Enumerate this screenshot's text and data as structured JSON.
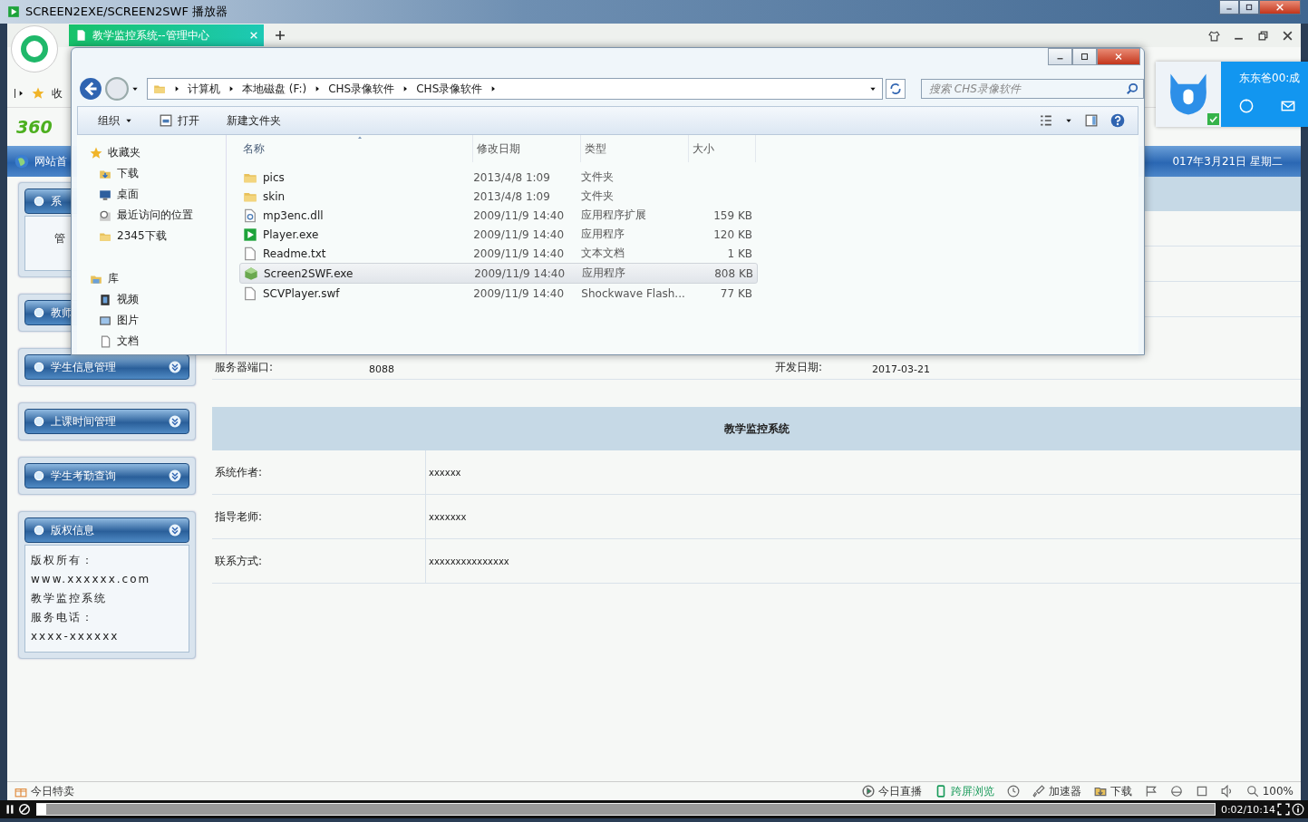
{
  "player": {
    "title": "SCREEN2EXE/SCREEN2SWF 播放器",
    "playing": true,
    "progress": {
      "level": 0.004
    },
    "time": "0:02/10:14"
  },
  "browser": {
    "tab": {
      "title": "教学监控系统--管理中心",
      "selected": true
    },
    "bookmark": "收",
    "logo": "360",
    "nav_item": "网站首",
    "date": "017年3月21日  星期二"
  },
  "sidebar": [
    {
      "title": "系",
      "lines": [
        "管"
      ]
    },
    {
      "title": "教师"
    },
    {
      "title": "学生信息管理",
      "chevron": true
    },
    {
      "title": "上课时间管理",
      "chevron": true
    },
    {
      "title": "学生考勤查询",
      "chevron": true
    },
    {
      "title": "版权信息",
      "chevron": true,
      "lines": [
        "版权所有：",
        "www.xxxxxx.com",
        "教学监控系统",
        "服务电话：",
        "xxxx-xxxxxx"
      ]
    }
  ],
  "server_info": [
    {
      "label": "服务器端口:",
      "value": "8088"
    },
    {
      "label": "开发日期:",
      "value": "2017-03-21"
    }
  ],
  "about": {
    "title": "教学监控系统",
    "rows": [
      {
        "label": "系统作者:",
        "value": "xxxxxx"
      },
      {
        "label": "指导老师:",
        "value": "xxxxxxx"
      },
      {
        "label": "联系方式:",
        "value": "xxxxxxxxxxxxxxx"
      }
    ]
  },
  "status_bar": {
    "left": "今日特卖",
    "items": [
      {
        "kind": "live",
        "label": "今日直播",
        "active": false
      },
      {
        "kind": "phone",
        "label": "跨屏浏览",
        "active": true
      },
      {
        "kind": "clock",
        "active": false
      },
      {
        "kind": "rocket",
        "label": "加速器",
        "active": false
      },
      {
        "kind": "download",
        "label": "下载",
        "active": false
      },
      {
        "kind": "flag",
        "active": false
      },
      {
        "kind": "ie",
        "active": false
      },
      {
        "kind": "window",
        "active": false
      },
      {
        "kind": "sound",
        "active": false
      },
      {
        "kind": "zoom",
        "label": "100%",
        "active": false
      }
    ]
  },
  "explorer": {
    "breadcrumb": [
      "计算机",
      "本地磁盘 (F:)",
      "CHS录像软件",
      "CHS录像软件"
    ],
    "search": {
      "placeholder": "搜索 CHS录像软件"
    },
    "toolbar": [
      {
        "kind": "menu",
        "label": "组织"
      },
      {
        "kind": "open",
        "label": "打开"
      },
      {
        "kind": "plain",
        "label": "新建文件夹"
      }
    ],
    "nav": [
      {
        "kind": "star",
        "label": "收藏夹",
        "children": [
          {
            "kind": "download",
            "label": "下载"
          },
          {
            "kind": "desktop",
            "label": "桌面"
          },
          {
            "kind": "recent",
            "label": "最近访问的位置"
          },
          {
            "kind": "folder",
            "label": "2345下载"
          }
        ]
      },
      {
        "kind": "library",
        "label": "库",
        "children": [
          {
            "kind": "video",
            "label": "视频"
          },
          {
            "kind": "picture",
            "label": "图片"
          },
          {
            "kind": "doc",
            "label": "文档"
          }
        ]
      }
    ],
    "columns": [
      {
        "label": "名称",
        "sorted": true
      },
      {
        "label": "修改日期",
        "sorted": false
      },
      {
        "label": "类型",
        "sorted": false
      },
      {
        "label": "大小",
        "sorted": false
      }
    ],
    "files": [
      {
        "kind": "folder",
        "name": "pics",
        "date": "2013/4/8 1:09",
        "type": "文件夹",
        "selected": false
      },
      {
        "kind": "folder",
        "name": "skin",
        "date": "2013/4/8 1:09",
        "type": "文件夹",
        "selected": false
      },
      {
        "kind": "dll",
        "name": "mp3enc.dll",
        "date": "2009/11/9 14:40",
        "type": "应用程序扩展",
        "size": "159 KB",
        "selected": false
      },
      {
        "kind": "player",
        "name": "Player.exe",
        "date": "2009/11/9 14:40",
        "type": "应用程序",
        "size": "120 KB",
        "selected": false
      },
      {
        "kind": "file",
        "name": "Readme.txt",
        "date": "2009/11/9 14:40",
        "type": "文本文档",
        "size": "1 KB",
        "selected": false
      },
      {
        "kind": "app",
        "name": "Screen2SWF.exe",
        "date": "2009/11/9 14:40",
        "type": "应用程序",
        "size": "808 KB",
        "selected": true
      },
      {
        "kind": "file",
        "name": "SCVPlayer.swf",
        "date": "2009/11/9 14:40",
        "type": "Shockwave Flash...",
        "size": "77 KB",
        "selected": false
      }
    ]
  },
  "qq": {
    "name": "东东爸00:成",
    "online": true
  }
}
